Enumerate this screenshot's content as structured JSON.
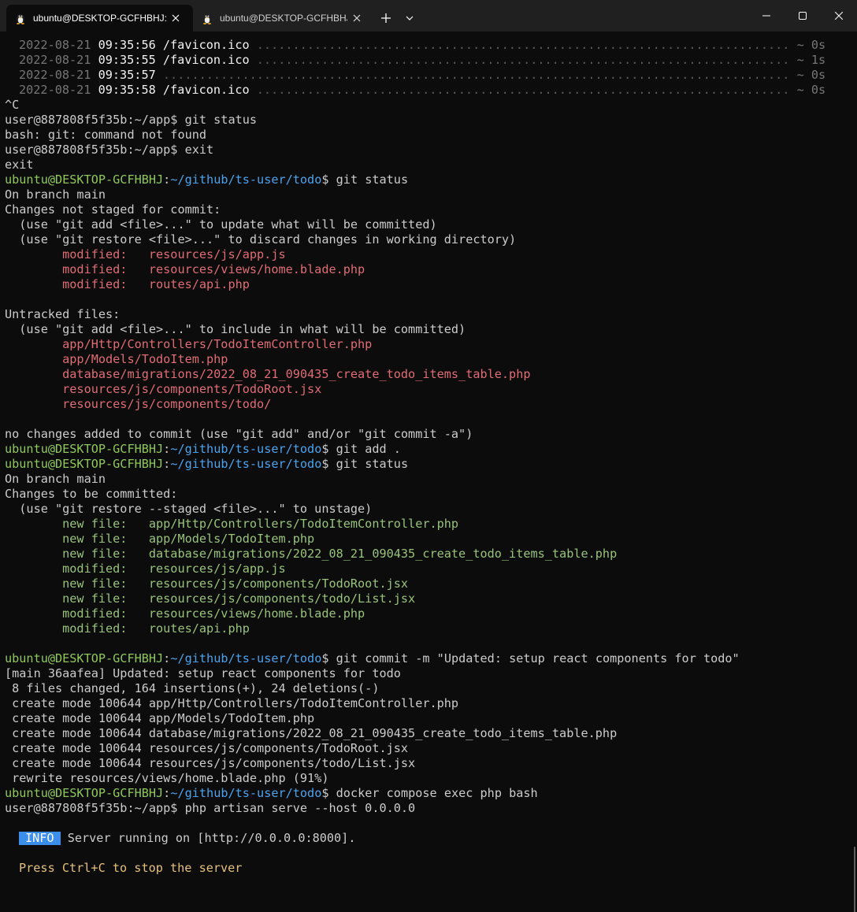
{
  "tabs": [
    {
      "title": "ubuntu@DESKTOP-GCFHBHJ: ~",
      "active": true
    },
    {
      "title": "ubuntu@DESKTOP-GCFHBHJ: ~",
      "active": false
    }
  ],
  "icons": {
    "tab_icon": "linux-tux-icon",
    "close": "close-icon",
    "new_tab": "plus-icon",
    "dropdown": "chevron-down-icon",
    "minimize": "minimize-icon",
    "maximize": "maximize-icon",
    "window_close": "window-close-icon"
  },
  "prompt": {
    "user": "ubuntu@DESKTOP-GCFHBHJ",
    "path": "~/github/ts-user/todo",
    "container": "user@887808f5f35b:~/app$ "
  },
  "log": [
    {
      "date": "2022-08-21",
      "time": "09:35:56",
      "path": " /favicon.ico ",
      "dur": "~ 0s"
    },
    {
      "date": "2022-08-21",
      "time": "09:35:55",
      "path": " /favicon.ico ",
      "dur": "~ 1s"
    },
    {
      "date": "2022-08-21",
      "time": "09:35:57",
      "path": " ",
      "dur": "~ 0s"
    },
    {
      "date": "2022-08-21",
      "time": "09:35:58",
      "path": " /favicon.ico ",
      "dur": "~ 0s"
    }
  ],
  "lines": {
    "ctrlc": "^C",
    "cmd_git_status_1": "git status",
    "git_not_found": "bash: git: command not found",
    "cmd_exit": "exit",
    "exit": "exit",
    "cmd_git_status_2": " git status",
    "on_branch": "On branch main",
    "not_staged": "Changes not staged for commit:",
    "hint_add": "  (use \"git add <file>...\" to update what will be committed)",
    "hint_restore": "  (use \"git restore <file>...\" to discard changes in working directory)",
    "mod1": "        modified:   resources/js/app.js",
    "mod2": "        modified:   resources/views/home.blade.php",
    "mod3": "        modified:   routes/api.php",
    "untracked": "Untracked files:",
    "hint_include": "  (use \"git add <file>...\" to include in what will be committed)",
    "u1": "        app/Http/Controllers/TodoItemController.php",
    "u2": "        app/Models/TodoItem.php",
    "u3": "        database/migrations/2022_08_21_090435_create_todo_items_table.php",
    "u4": "        resources/js/components/TodoRoot.jsx",
    "u5": "        resources/js/components/todo/",
    "no_changes": "no changes added to commit (use \"git add\" and/or \"git commit -a\")",
    "cmd_git_add": " git add .",
    "cmd_git_status_3": " git status",
    "on_branch_2": "On branch main",
    "to_be_committed": "Changes to be committed:",
    "hint_unstage": "  (use \"git restore --staged <file>...\" to unstage)",
    "s1": "        new file:   app/Http/Controllers/TodoItemController.php",
    "s2": "        new file:   app/Models/TodoItem.php",
    "s3": "        new file:   database/migrations/2022_08_21_090435_create_todo_items_table.php",
    "s4": "        modified:   resources/js/app.js",
    "s5": "        new file:   resources/js/components/TodoRoot.jsx",
    "s6": "        new file:   resources/js/components/todo/List.jsx",
    "s7": "        modified:   resources/views/home.blade.php",
    "s8": "        modified:   routes/api.php",
    "cmd_commit": " git commit -m \"Updated: setup react components for todo\"",
    "commit_head": "[main 36aafea] Updated: setup react components for todo",
    "commit_stats": " 8 files changed, 164 insertions(+), 24 deletions(-)",
    "c1": " create mode 100644 app/Http/Controllers/TodoItemController.php",
    "c2": " create mode 100644 app/Models/TodoItem.php",
    "c3": " create mode 100644 database/migrations/2022_08_21_090435_create_todo_items_table.php",
    "c4": " create mode 100644 resources/js/components/TodoRoot.jsx",
    "c5": " create mode 100644 resources/js/components/todo/List.jsx",
    "c6": " rewrite resources/views/home.blade.php (91%)",
    "cmd_docker": " docker compose exec php bash",
    "cmd_serve": "php artisan serve --host 0.0.0.0",
    "info_badge": "INFO",
    "info_text": " Server running on [http://0.0.0.0:8000].",
    "stop_hint": "Press Ctrl+C to stop the server"
  }
}
